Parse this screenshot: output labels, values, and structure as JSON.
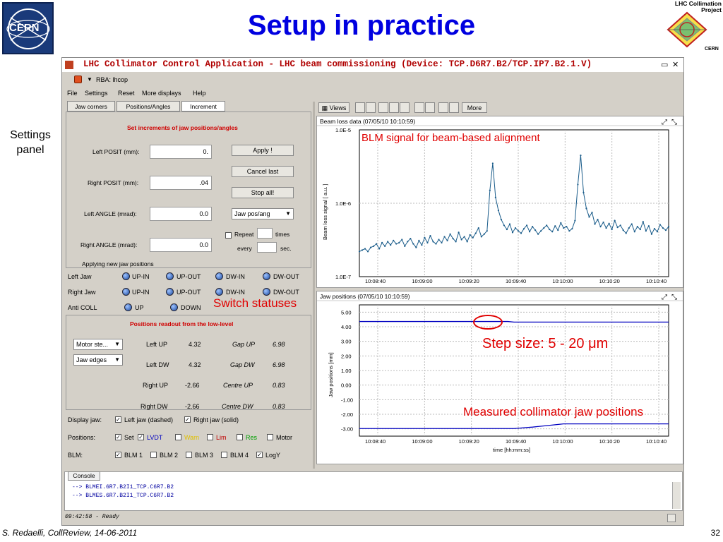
{
  "slide": {
    "title": "Setup in practice",
    "cern_logo_text": "CERN",
    "lhc_logo_text": "LHC Collimation Project",
    "lhc_logo_sub": "CERN",
    "footer_left": "S. Redaelli, CollReview, 14-06-2011",
    "page_number": "32",
    "annotations": {
      "settings_panel": "Settings panel",
      "blm_signal": "BLM signal for beam-based alignment",
      "switch_statuses": "Switch statuses",
      "step_size": "Step size: 5 - 20 μm",
      "measured": "Measured collimator jaw positions"
    }
  },
  "app": {
    "window_title": "LHC Collimator Control Application - LHC beam commissioning (Device: TCP.D6R7.B2/TCP.IP7.B2.1.V)",
    "rba": "RBA: lhcop",
    "menu": [
      "File",
      "Settings",
      "Reset",
      "More displays",
      "Help"
    ],
    "tabs": [
      "Jaw corners",
      "Positions/Angles",
      "Increment"
    ],
    "set_increments_heading": "Set increments of jaw positions/angles",
    "fields": [
      {
        "label": "Left POSIT (mm):",
        "value": "0."
      },
      {
        "label": "Right POSIT (mm):",
        "value": ".04"
      },
      {
        "label": "Left ANGLE (mrad):",
        "value": "0.0"
      },
      {
        "label": "Right ANGLE (mrad):",
        "value": "0.0"
      }
    ],
    "buttons": {
      "apply": "Apply !",
      "cancel": "Cancel last",
      "stop": "Stop all!"
    },
    "jaw_combo": "Jaw pos/ang",
    "repeat_label": "Repeat",
    "times_label": "times",
    "every_label": "every",
    "sec_label": "sec.",
    "applying_label": "Applying new jaw positions",
    "switches": {
      "left_jaw": "Left Jaw",
      "right_jaw": "Right Jaw",
      "anti_coll": "Anti COLL",
      "up_in": "UP-IN",
      "up_out": "UP-OUT",
      "dw_in": "DW-IN",
      "dw_out": "DW-OUT",
      "up": "UP",
      "down": "DOWN"
    },
    "readout_heading": "Positions readout from the low-level",
    "motor_combo": "Motor ste...",
    "edges_combo": "Jaw edges",
    "readout": [
      {
        "name": "Left UP",
        "value": "4.32",
        "gname": "Gap UP",
        "gvalue": "6.98"
      },
      {
        "name": "Left DW",
        "value": "4.32",
        "gname": "Gap DW",
        "gvalue": "6.98"
      },
      {
        "name": "Right UP",
        "value": "-2.66",
        "gname": "Centre UP",
        "gvalue": "0.83"
      },
      {
        "name": "Right DW",
        "value": "-2.66",
        "gname": "Centre DW",
        "gvalue": "0.83"
      }
    ],
    "display_jaw_label": "Display jaw:",
    "display_jaw_opts": [
      "Left jaw (dashed)",
      "Right jaw (solid)"
    ],
    "positions_label": "Positions:",
    "positions_opts": [
      {
        "label": "Set",
        "checked": true,
        "color": "#000000"
      },
      {
        "label": "LVDT",
        "checked": true,
        "color": "#0000c0"
      },
      {
        "label": "Warn",
        "checked": false,
        "color": "#e0c000"
      },
      {
        "label": "Lim",
        "checked": false,
        "color": "#c00000"
      },
      {
        "label": "Res",
        "checked": false,
        "color": "#00a000"
      },
      {
        "label": "Motor",
        "checked": false,
        "color": "#000000"
      }
    ],
    "blm_label": "BLM:",
    "blm_opts": [
      {
        "label": "BLM 1",
        "checked": true
      },
      {
        "label": "BLM 2",
        "checked": false
      },
      {
        "label": "BLM 3",
        "checked": false
      },
      {
        "label": "BLM 4",
        "checked": false
      },
      {
        "label": "LogY",
        "checked": true
      }
    ],
    "views_button": "Views",
    "more_button": "More",
    "console_tab": "Console",
    "console_lines": [
      "--> BLMEI.6R7.B2I1_TCP.C6R7.B2",
      "--> BLMES.6R7.B2I1_TCP.C6R7.B2"
    ],
    "status_text": "09:42:58 - Ready"
  },
  "chart_data": [
    {
      "type": "line",
      "title": "Beam loss data  (07/05/10 10:10:59)",
      "ylabel": "Beam loss signal [ a.u. ]",
      "yscale": "log",
      "ylim": [
        1e-07,
        1e-05
      ],
      "y_tick_labels": [
        "1.0E-5",
        "1.0E-6",
        "1.0E-7"
      ],
      "x_tick_labels": [
        "10:08:40",
        "10:09:00",
        "10:09:20",
        "10:09:40",
        "10:10:00",
        "10:10:20",
        "10:10:40"
      ],
      "series": [
        {
          "color": "#1a5c8a",
          "values": [
            2.2e-07,
            2.3e-07,
            2.4e-07,
            2.2e-07,
            2.5e-07,
            2.6e-07,
            2.8e-07,
            2.4e-07,
            2.9e-07,
            2.6e-07,
            3e-07,
            2.7e-07,
            3.1e-07,
            2.8e-07,
            2.9e-07,
            3.2e-07,
            2.6e-07,
            3e-07,
            3.3e-07,
            2.8e-07,
            2.5e-07,
            3.1e-07,
            2.7e-07,
            3.4e-07,
            2.9e-07,
            3.6e-07,
            3e-07,
            2.8e-07,
            3.2e-07,
            2.9e-07,
            3.5e-07,
            3.1e-07,
            3.8e-07,
            3.3e-07,
            3e-07,
            4e-07,
            3.2e-07,
            3.5e-07,
            3e-07,
            3.7e-07,
            3.4e-07,
            3.9e-07,
            4.6e-07,
            3.5e-07,
            3.8e-07,
            4.2e-07,
            1.5e-06,
            3.5e-06,
            1.2e-06,
            8e-07,
            6e-07,
            5e-07,
            4.4e-07,
            5.2e-07,
            4e-07,
            4.6e-07,
            4.2e-07,
            3.9e-07,
            4.5e-07,
            5e-07,
            4.1e-07,
            4.8e-07,
            4.3e-07,
            3.8e-07,
            4.2e-07,
            4.6e-07,
            5e-07,
            4.4e-07,
            4.1e-07,
            4.9e-07,
            4.3e-07,
            5.4e-07,
            4.6e-07,
            4.8e-07,
            4.2e-07,
            4.5e-07,
            5.8e-07,
            1.8e-06,
            4.5e-06,
            1.4e-06,
            8.5e-07,
            6.5e-07,
            7.5e-07,
            5.2e-07,
            6e-07,
            4.8e-07,
            5.5e-07,
            4.6e-07,
            5.3e-07,
            4.4e-07,
            5.8e-07,
            4.7e-07,
            5e-07,
            4.3e-07,
            3.9e-07,
            4.6e-07,
            5.2e-07,
            4.1e-07,
            4.8e-07,
            4.4e-07,
            5.6e-07,
            4.2e-07,
            4.9e-07,
            3.8e-07,
            4.5e-07,
            4.1e-07,
            5.1e-07,
            4.6e-07,
            4.3e-07,
            4.8e-07
          ]
        }
      ]
    },
    {
      "type": "line",
      "title": "Jaw positions  (07/05/10 10:10:59)",
      "xlabel": "time [hh:mm:ss]",
      "ylabel": "Jaw positions [mm]",
      "ylim": [
        -3.5,
        5.5
      ],
      "y_tick_labels": [
        "5.00",
        "4.00",
        "3.00",
        "2.00",
        "1.00",
        "0.00",
        "-1.00",
        "-2.00",
        "-3.00"
      ],
      "x_tick_labels": [
        "10:08:40",
        "10:09:00",
        "10:09:20",
        "10:09:40",
        "10:10:00",
        "10:10:20",
        "10:10:40"
      ],
      "series": [
        {
          "color": "#0000c0",
          "x_frac": [
            0,
            0.48,
            0.5,
            0.53,
            1
          ],
          "values": [
            4.36,
            4.36,
            4.32,
            4.32,
            4.32
          ]
        },
        {
          "color": "#0000c0",
          "x_frac": [
            0,
            0.5,
            0.56,
            0.66,
            1
          ],
          "values": [
            -2.98,
            -2.98,
            -2.88,
            -2.66,
            -2.66
          ]
        }
      ]
    }
  ]
}
